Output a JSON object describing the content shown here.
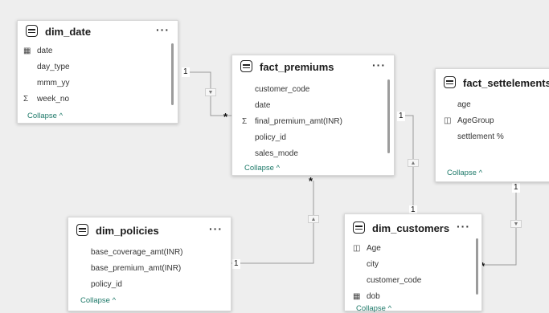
{
  "tables": {
    "dim_date": {
      "title": "dim_date",
      "fields": [
        "date",
        "day_type",
        "mmm_yy",
        "week_no"
      ],
      "field_icons": [
        "calendar-icon",
        "none",
        "none",
        "sigma-icon"
      ],
      "collapse": "Collapse ^"
    },
    "fact_premiums": {
      "title": "fact_premiums",
      "fields": [
        "customer_code",
        "date",
        "final_premium_amt(INR)",
        "policy_id",
        "sales_mode"
      ],
      "field_icons": [
        "none",
        "none",
        "sigma-icon",
        "none",
        "none"
      ],
      "collapse": "Collapse ^"
    },
    "fact_settelements": {
      "title": "fact_settelements",
      "fields": [
        "age",
        "AgeGroup",
        "settlement %"
      ],
      "field_icons": [
        "none",
        "group-icon",
        "none"
      ],
      "collapse": "Collapse ^"
    },
    "dim_policies": {
      "title": "dim_policies",
      "fields": [
        "base_coverage_amt(INR)",
        "base_premium_amt(INR)",
        "policy_id"
      ],
      "collapse": "Collapse ^"
    },
    "dim_customers": {
      "title": "dim_customers",
      "fields": [
        "Age",
        "city",
        "customer_code",
        "dob"
      ],
      "field_icons": [
        "group-icon",
        "none",
        "none",
        "calendar-icon"
      ],
      "collapse": "Collapse ^"
    }
  },
  "more_label": "···",
  "cardinality": {
    "one": "1",
    "many": "*"
  },
  "relationships": [
    {
      "from": "dim_date",
      "to": "fact_premiums",
      "from_card": "1",
      "to_card": "*"
    },
    {
      "from": "fact_premiums",
      "to": "dim_customers",
      "from_card": "1",
      "to_card": "1"
    },
    {
      "from": "dim_policies",
      "to": "fact_premiums",
      "from_card": "1",
      "to_card": "*"
    },
    {
      "from": "fact_settelements",
      "to": "dim_customers",
      "from_card": "1",
      "to_card": "*"
    }
  ],
  "colors": {
    "canvas": "#eeeeee",
    "line": "#9a9a9a",
    "collapse": "#1f7a6a"
  }
}
